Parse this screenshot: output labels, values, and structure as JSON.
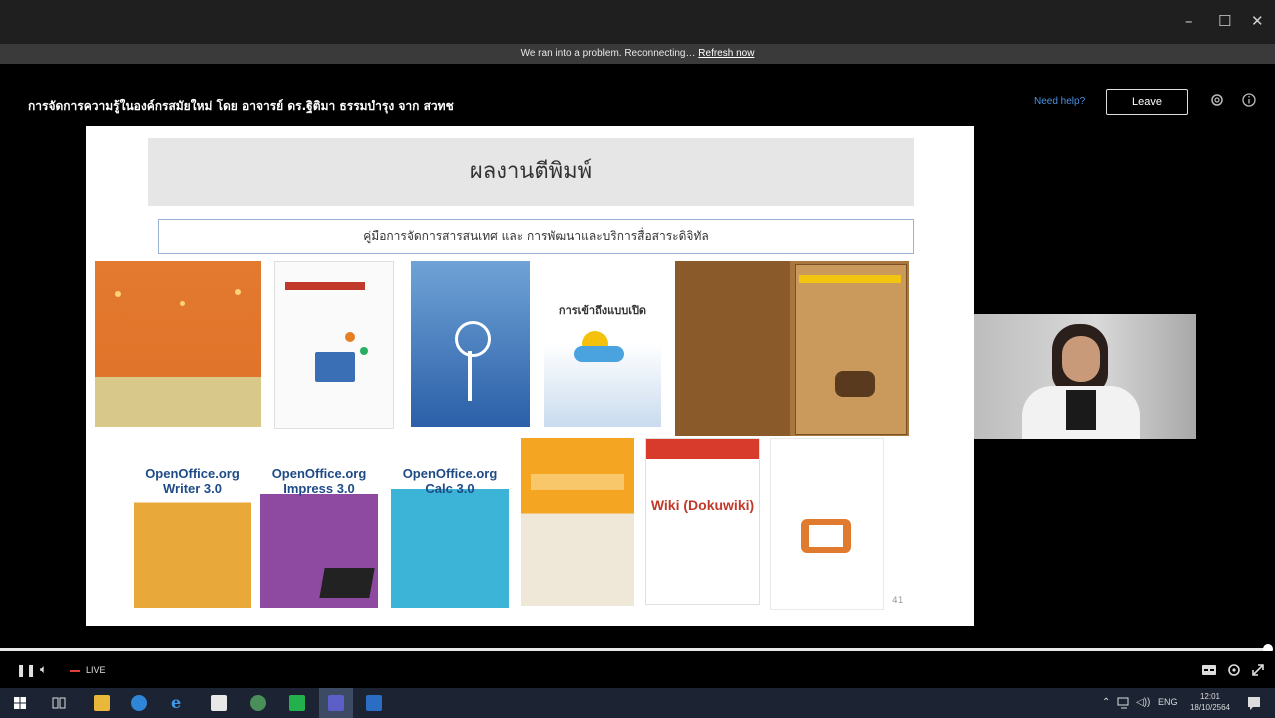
{
  "banner": {
    "message": "We ran into a problem. Reconnecting…",
    "action": "Refresh now"
  },
  "header": {
    "title": "การจัดการความรู้ในองค์กรสมัยใหม่ โดย อาจารย์ ดร.ฐิติมา ธรรมบำรุง จาก สวทช",
    "need_help": "Need help?",
    "leave": "Leave"
  },
  "slide": {
    "title": "ผลงานตีพิมพ์",
    "subtitle": "คู่มือการจัดการสารสนเทศ และ การพัฒนาและบริการสื่อสาระดิจิทัล",
    "page_number": "41",
    "covers": [
      {
        "text": ""
      },
      {
        "text": ""
      },
      {
        "text": ""
      },
      {
        "text": "การเข้าถึงแบบเปิด"
      },
      {
        "text": ""
      },
      {
        "text": "OpenOffice.org Writer 3.0"
      },
      {
        "text": "OpenOffice.org Impress 3.0"
      },
      {
        "text": "OpenOffice.org Calc 3.0"
      },
      {
        "text": ""
      },
      {
        "text": "Wiki (Dokuwiki)"
      },
      {
        "text": ""
      }
    ]
  },
  "controls": {
    "live": "LIVE"
  },
  "taskbar": {
    "lang": "ENG",
    "time": "12:01",
    "date": "18/10/2564"
  },
  "icons": {
    "minimize": "minimize-icon",
    "maximize": "maximize-icon",
    "close": "close-icon",
    "settings": "gear-icon",
    "info": "info-icon",
    "pause": "pause-icon",
    "volume": "volume-icon",
    "captions": "captions-icon",
    "quality": "gear-icon",
    "fullscreen": "fullscreen-icon"
  },
  "colors": {
    "accent": "#4a90e2",
    "live_dot": "#e0403a"
  }
}
